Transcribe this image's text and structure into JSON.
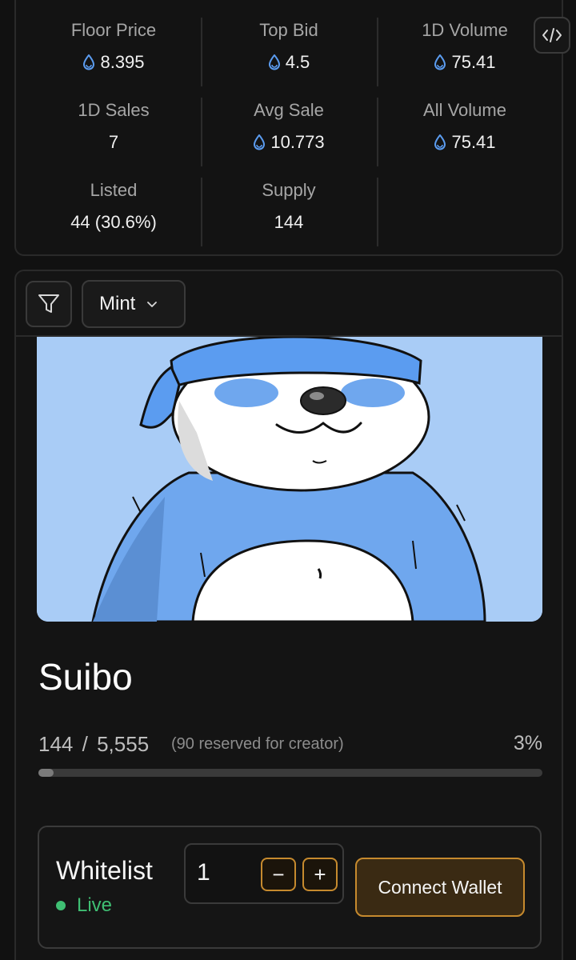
{
  "stats": [
    {
      "label": "Floor Price",
      "value": "8.395",
      "sui": true
    },
    {
      "label": "Top Bid",
      "value": "4.5",
      "sui": true
    },
    {
      "label": "1D Volume",
      "value": "75.41",
      "sui": true
    },
    {
      "label": "1D Sales",
      "value": "7",
      "sui": false
    },
    {
      "label": "Avg Sale",
      "value": "10.773",
      "sui": true
    },
    {
      "label": "All Volume",
      "value": "75.41",
      "sui": true
    },
    {
      "label": "Listed",
      "value": "44 (30.6%)",
      "sui": false
    },
    {
      "label": "Supply",
      "value": "144",
      "sui": false
    }
  ],
  "toolbar": {
    "mint_select": "Mint"
  },
  "collection": {
    "name": "Suibo",
    "minted": "144",
    "separator": "/",
    "total": "5,555",
    "reserved_note": "(90 reserved for creator)",
    "percent_label": "3%",
    "progress_fraction": 0.03
  },
  "phase": {
    "name": "Whitelist",
    "status": "Live",
    "quantity": "1",
    "minus_label": "−",
    "plus_label": "+",
    "connect_label": "Connect Wallet"
  },
  "colors": {
    "background": "#111111",
    "sui_blue": "#5b9cf0",
    "accent_orange": "#c68a2e",
    "live_green": "#3fbf73",
    "image_bg": "#a9ccf6"
  },
  "icons": [
    "sui-drop-icon",
    "embed-code-icon",
    "filter-icon",
    "chevron-down-icon"
  ]
}
